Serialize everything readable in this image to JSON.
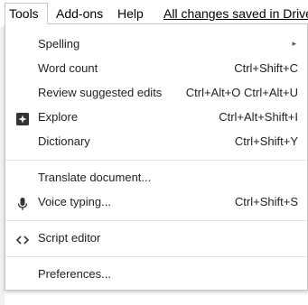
{
  "menubar": {
    "tools": "Tools",
    "addons": "Add-ons",
    "help": "Help",
    "saved_status": "All changes saved in Drive"
  },
  "tools_menu": {
    "spelling": {
      "label": "Spelling",
      "submenu_arrow": "▸"
    },
    "word_count": {
      "label": "Word count",
      "shortcut": "Ctrl+Shift+C"
    },
    "review_edits": {
      "label": "Review suggested edits",
      "shortcut": "Ctrl+Alt+O Ctrl+Alt+U"
    },
    "explore": {
      "label": "Explore",
      "shortcut": "Ctrl+Alt+Shift+I",
      "icon": "explore-icon"
    },
    "dictionary": {
      "label": "Dictionary",
      "shortcut": "Ctrl+Shift+Y"
    },
    "translate": {
      "label": "Translate document..."
    },
    "voice_typing": {
      "label": "Voice typing...",
      "shortcut": "Ctrl+Shift+S",
      "icon": "microphone-icon"
    },
    "script_editor": {
      "label": "Script editor",
      "icon": "code-icon"
    },
    "preferences": {
      "label": "Preferences..."
    }
  }
}
